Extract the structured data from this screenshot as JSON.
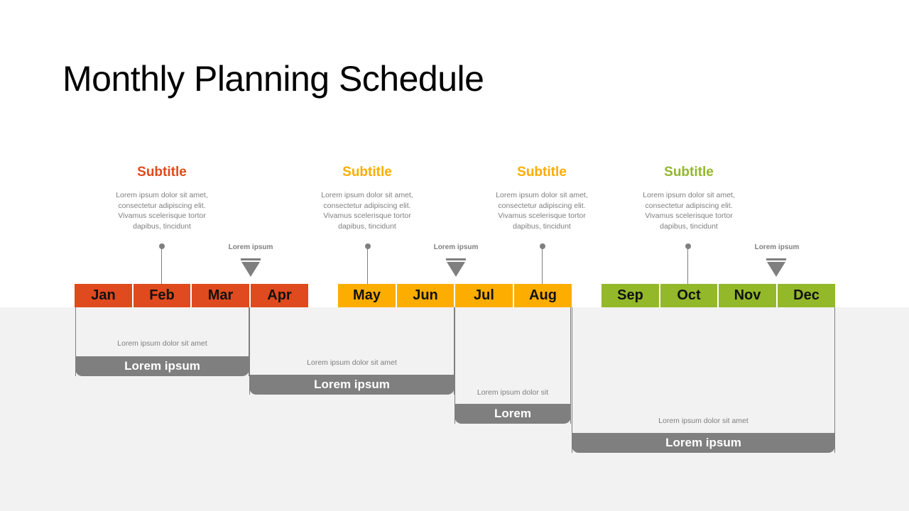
{
  "title": "Monthly Planning Schedule",
  "colors": {
    "q1": "#df4a1e",
    "q2": "#fdad00",
    "q3": "#93b82a",
    "gray": "#7f7f7f"
  },
  "subtitles": [
    {
      "label": "Subtitle",
      "text": [
        "Lorem ipsum dolor sit amet,",
        "consectetur adipiscing elit.",
        "Vivamus scelerisque tortor",
        "dapibus, tincidunt"
      ]
    },
    {
      "label": "Subtitle",
      "text": [
        "Lorem ipsum dolor sit amet,",
        "consectetur adipiscing elit.",
        "Vivamus scelerisque tortor",
        "dapibus, tincidunt"
      ]
    },
    {
      "label": "Subtitle",
      "text": [
        "Lorem ipsum dolor sit amet,",
        "consectetur adipiscing elit.",
        "Vivamus scelerisque tortor",
        "dapibus, tincidunt"
      ]
    },
    {
      "label": "Subtitle",
      "text": [
        "Lorem ipsum dolor sit amet,",
        "consectetur adipiscing elit.",
        "Vivamus scelerisque tortor",
        "dapibus, tincidunt"
      ]
    }
  ],
  "markers": [
    "Lorem ipsum",
    "Lorem ipsum",
    "Lorem ipsum"
  ],
  "months": [
    "Jan",
    "Feb",
    "Mar",
    "Apr",
    "May",
    "Jun",
    "Jul",
    "Aug",
    "Sep",
    "Oct",
    "Nov",
    "Dec"
  ],
  "boxes": [
    {
      "text": "Lorem ipsum dolor sit amet",
      "label": "Lorem ipsum"
    },
    {
      "text": "Lorem ipsum dolor sit amet",
      "label": "Lorem ipsum"
    },
    {
      "text": "Lorem ipsum dolor sit",
      "label": "Lorem"
    },
    {
      "text": "Lorem ipsum dolor sit amet",
      "label": "Lorem ipsum"
    }
  ]
}
